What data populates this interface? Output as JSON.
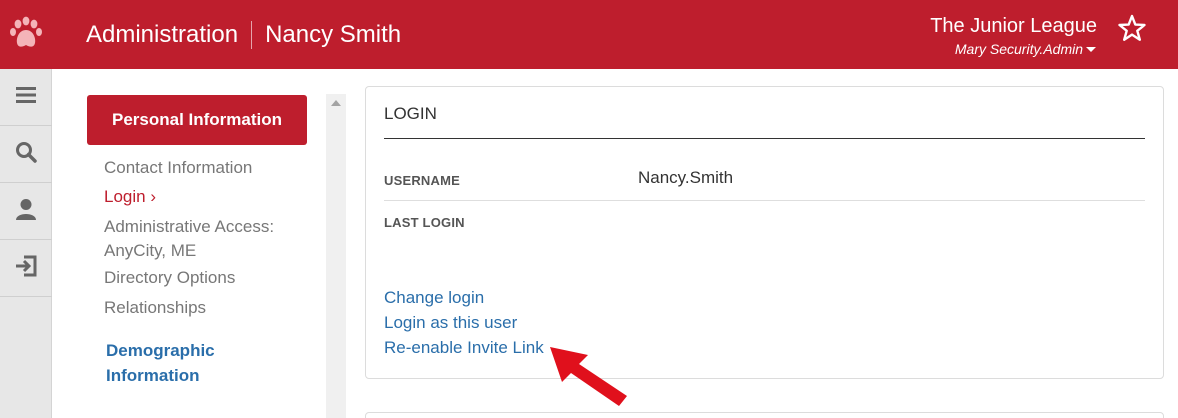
{
  "header": {
    "title": "Administration",
    "subject": "Nancy Smith",
    "org_name": "The Junior League",
    "user_menu": "Mary Security.Admin",
    "logo_icon": "paw-icon",
    "favorite_icon": "star-outline-icon",
    "brand_color": "#be1e2d"
  },
  "rail": {
    "items": [
      {
        "icon": "menu-icon"
      },
      {
        "icon": "search-icon"
      },
      {
        "icon": "user-icon"
      },
      {
        "icon": "logout-icon"
      }
    ]
  },
  "sidenav": {
    "section_button": "Personal Information",
    "links": [
      "Contact Information",
      "Login ›",
      "Administrative Access:",
      "AnyCity, ME",
      "Directory Options",
      "Relationships"
    ],
    "active_link": "Login ›",
    "section2": "Demographic Information"
  },
  "panel": {
    "title": "LOGIN",
    "username_label": "USERNAME",
    "username_value": "Nancy.Smith",
    "last_login_label": "LAST LOGIN",
    "actions": [
      "Change login",
      "Login as this user",
      "Re-enable Invite Link"
    ]
  },
  "annotation": {
    "arrow_icon": "red-pointer-arrow-icon",
    "arrow_color": "#e0101c"
  }
}
